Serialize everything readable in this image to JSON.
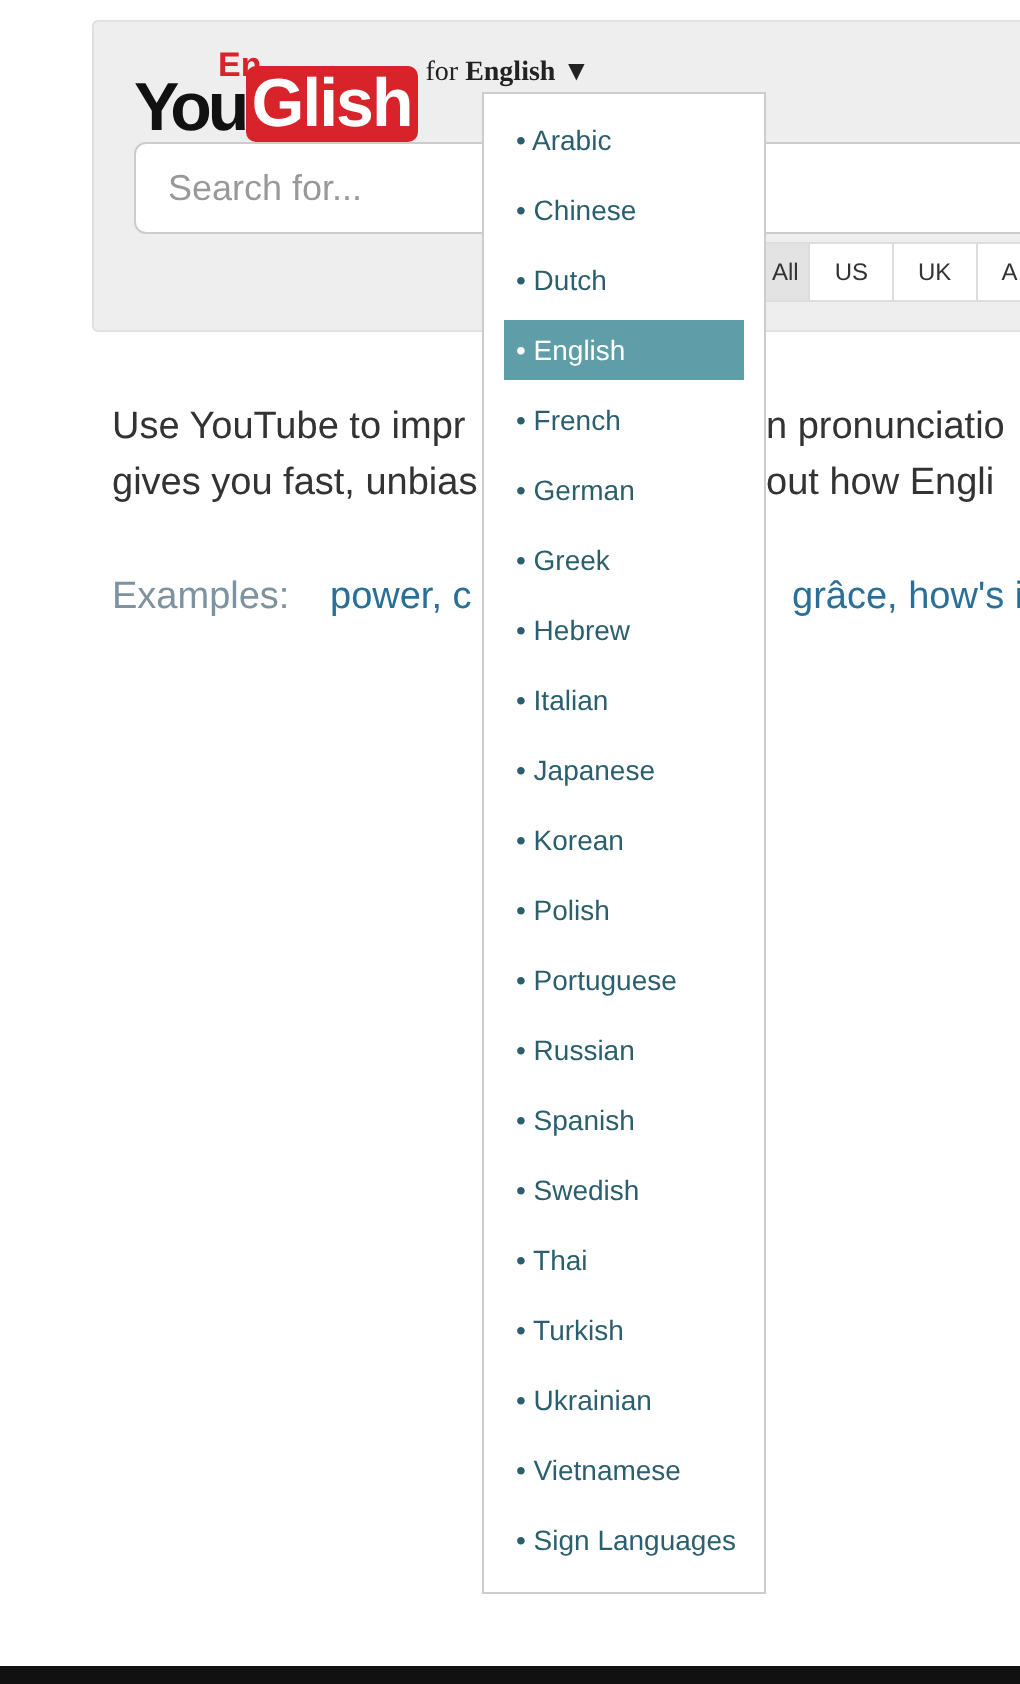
{
  "logo": {
    "you": "You",
    "en": "En",
    "glish": "Glish"
  },
  "language_picker": {
    "prefix": "for",
    "current": "English",
    "caret": "▼"
  },
  "search": {
    "placeholder": "Search for..."
  },
  "accents": [
    {
      "label": "All",
      "selected": true
    },
    {
      "label": "US",
      "selected": false
    },
    {
      "label": "UK",
      "selected": false
    },
    {
      "label": "A",
      "selected": false
    }
  ],
  "description": [
    {
      "left": "Use YouTube to impr",
      "right": "n pronunciatio"
    },
    {
      "left": "gives you fast, unbias",
      "right": "out how Engli"
    }
  ],
  "examples": {
    "label": "Examples:",
    "left_links": "power, c",
    "right_links": "grâce, how's i"
  },
  "languages": [
    {
      "name": "• Arabic",
      "selected": false
    },
    {
      "name": "• Chinese",
      "selected": false
    },
    {
      "name": "• Dutch",
      "selected": false
    },
    {
      "name": "• English",
      "selected": true
    },
    {
      "name": "• French",
      "selected": false
    },
    {
      "name": "• German",
      "selected": false
    },
    {
      "name": "• Greek",
      "selected": false
    },
    {
      "name": "• Hebrew",
      "selected": false
    },
    {
      "name": "• Italian",
      "selected": false
    },
    {
      "name": "• Japanese",
      "selected": false
    },
    {
      "name": "• Korean",
      "selected": false
    },
    {
      "name": "• Polish",
      "selected": false
    },
    {
      "name": "• Portuguese",
      "selected": false
    },
    {
      "name": "• Russian",
      "selected": false
    },
    {
      "name": "• Spanish",
      "selected": false
    },
    {
      "name": "• Swedish",
      "selected": false
    },
    {
      "name": "• Thai",
      "selected": false
    },
    {
      "name": "• Turkish",
      "selected": false
    },
    {
      "name": "• Ukrainian",
      "selected": false
    },
    {
      "name": "• Vietnamese",
      "selected": false
    },
    {
      "name": "• Sign Languages",
      "selected": false
    }
  ]
}
